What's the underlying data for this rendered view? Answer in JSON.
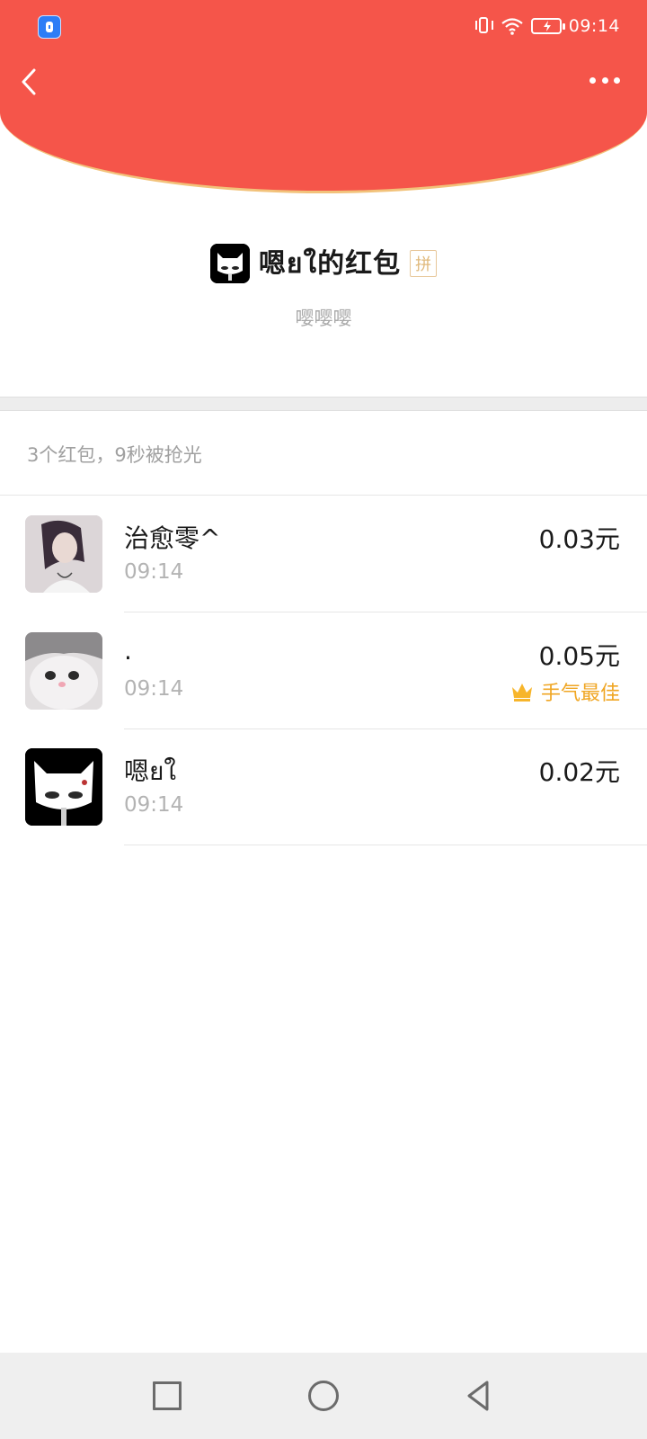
{
  "status_bar": {
    "time": "09:14",
    "icons": [
      "app-shield-icon",
      "vibrate-icon",
      "wifi-icon",
      "battery-charging-icon"
    ]
  },
  "header": {
    "back_icon": "chevron-left-icon",
    "more_icon": "more-dots-icon",
    "background": "#f5554a",
    "rim_color": "#f2c27a"
  },
  "packet": {
    "title": "嗯ยใ的红包",
    "badge": "拼",
    "message": "嘤嘤嘤"
  },
  "summary": "3个红包，9秒被抢光",
  "records": [
    {
      "name": "治愈零^",
      "time": "09:14",
      "amount": "0.03元",
      "best": ""
    },
    {
      "name": ".",
      "time": "09:14",
      "amount": "0.05元",
      "best": "手气最佳"
    },
    {
      "name": "嗯ยใ",
      "time": "09:14",
      "amount": "0.02元",
      "best": ""
    }
  ],
  "colors": {
    "best_luck": "#f0a623"
  },
  "navbar": {
    "icons": [
      "recent-apps-icon",
      "home-icon",
      "back-triangle-icon"
    ]
  }
}
